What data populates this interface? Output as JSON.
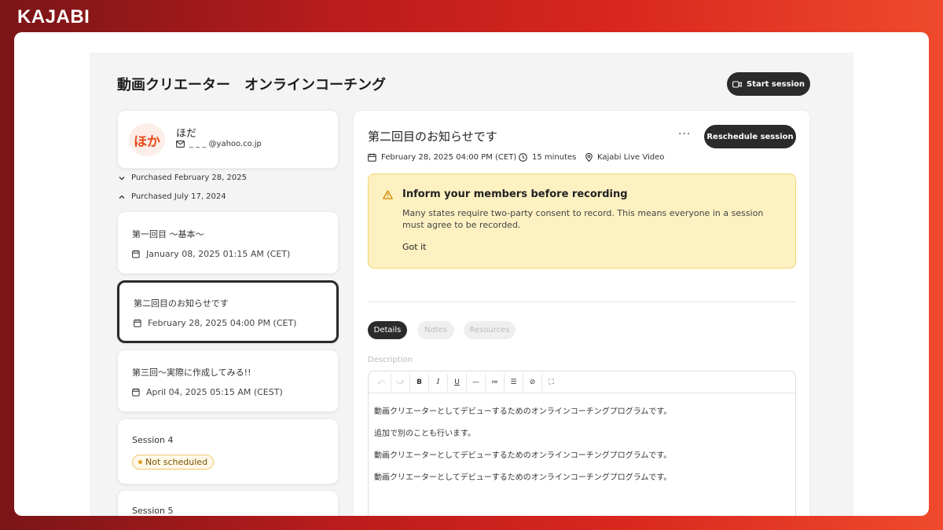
{
  "brand": "KAJABI",
  "page": {
    "title": "動画クリエーター　オンラインコーチング",
    "start_session_label": "Start session"
  },
  "member": {
    "avatar_text": "ほか",
    "name": "ほだ",
    "email": "_ _ _ @yahoo.co.jp"
  },
  "purchases": [
    {
      "label": "Purchased February 28, 2025",
      "expanded": false
    },
    {
      "label": "Purchased July 17, 2024",
      "expanded": true
    }
  ],
  "sessions": [
    {
      "title": "第一回目 ～基本～",
      "date": "January 08, 2025 01:15 AM (CET)"
    },
    {
      "title": "第二回目のお知らせです",
      "date": "February 28, 2025 04:00 PM (CET)"
    },
    {
      "title": "第三回～実際に作成してみる!!",
      "date": "April 04, 2025 05:15 AM (CEST)"
    },
    {
      "title": "Session 4",
      "badge": "Not scheduled"
    },
    {
      "title": "Session 5"
    }
  ],
  "detail": {
    "title": "第二回目のお知らせです",
    "more_label": "···",
    "reschedule_label": "Reschedule session",
    "date": "February 28, 2025 04:00 PM (CET)",
    "duration": "15 minutes",
    "location": "Kajabi Live Video",
    "alert": {
      "title": "Inform your members before recording",
      "text": "Many states require two-party consent to record. This means everyone in a session must agree to be recorded.",
      "action": "Got it"
    },
    "tabs": [
      "Details",
      "Notes",
      "Resources"
    ],
    "active_tab": "Details",
    "description_label": "Description",
    "toolbar": {
      "undo": "⤺",
      "redo": "⤻",
      "bold": "B",
      "italic": "I",
      "underline": "U",
      "hr": "—",
      "ordered_list": "≔",
      "bullet_list": "☰",
      "link": "⊘",
      "fullscreen": "⛶"
    },
    "paragraphs": [
      "動画クリエーターとしてデビューするためのオンラインコーチングプログラムです。",
      "追加で別のことも行います。",
      "動画クリエーターとしてデビューするためのオンラインコーチングプログラムです。",
      "動画クリエーターとしてデビューするためのオンラインコーチングプログラムです。"
    ]
  },
  "colors": {
    "accent_dark": "#2b2b2b",
    "alert_bg": "#fdf1c2",
    "avatar_text": "#e64a19"
  }
}
